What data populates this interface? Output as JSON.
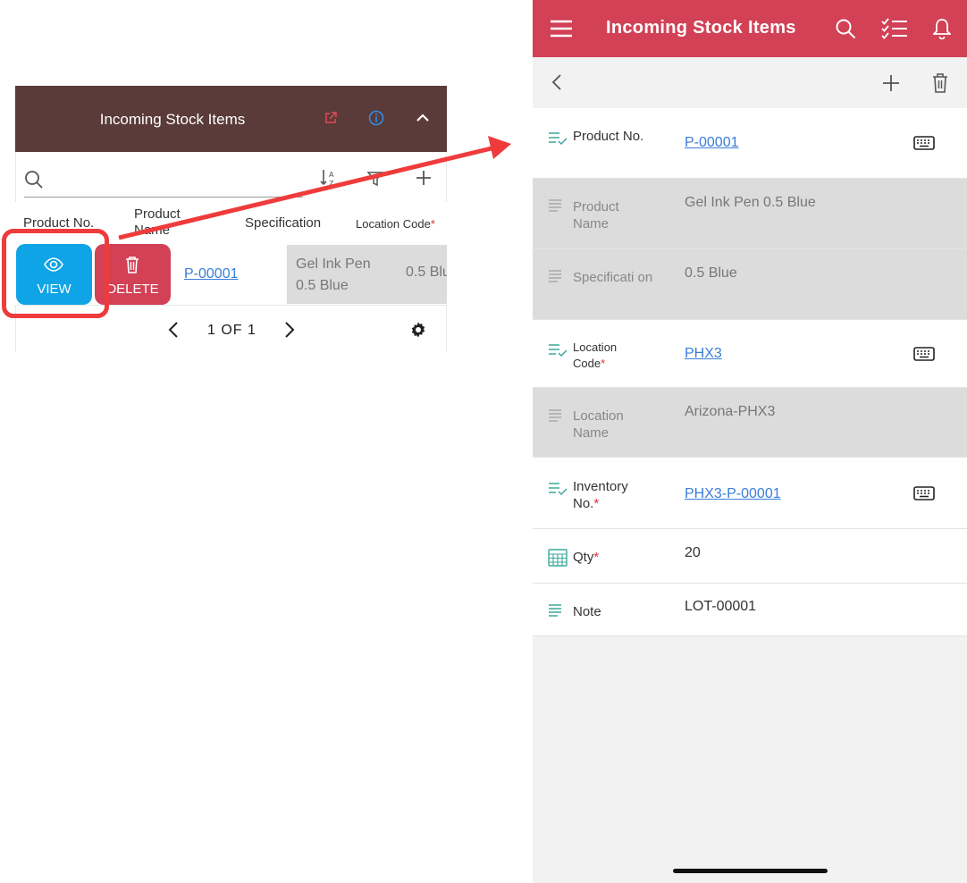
{
  "left_panel": {
    "title": "Incoming Stock Items",
    "columns": {
      "product_no": "Product No.",
      "product_name": "Product Name",
      "specification": "Specification",
      "location_code": "Location Code",
      "required_mark": "*"
    },
    "row": {
      "product_no": "P-00001",
      "specification": "Gel Ink Pen 0.5 Blue",
      "location_partial": "0.5 Blu"
    },
    "view_label": "VIEW",
    "delete_label": "DELETE",
    "pagination": "1 OF 1"
  },
  "right_panel": {
    "title": "Incoming Stock Items",
    "fields": {
      "product_no": {
        "label": "Product No.",
        "value": "P-00001"
      },
      "product_name": {
        "label": "Product Name",
        "value": "Gel Ink Pen 0.5 Blue"
      },
      "specification": {
        "label": "Specificati on",
        "value": "0.5 Blue"
      },
      "location_code": {
        "label": "Location Code",
        "value": "PHX3"
      },
      "location_name": {
        "label": "Location Name",
        "value": "Arizona-PHX3"
      },
      "inventory_no": {
        "label": "Inventory No.",
        "value": "PHX3-P-00001"
      },
      "qty": {
        "label": "Qty",
        "value": "20"
      },
      "note": {
        "label": "Note",
        "value": "LOT-00001"
      }
    },
    "required_mark": "*"
  },
  "colors": {
    "left_header": "#5a3b39",
    "right_header": "#d24155",
    "view_button": "#0fa4e6",
    "delete_button": "#d24155",
    "highlight": "#ef3b3b",
    "link": "#3a7dd8",
    "icon_teal": "#3ba99c"
  },
  "icons": [
    "external-link-icon",
    "info-icon",
    "chevron-up-icon",
    "search-icon",
    "sort-icon",
    "filter-icon",
    "plus-icon",
    "eye-icon",
    "trash-icon",
    "chevron-left-icon",
    "chevron-right-icon",
    "gear-icon",
    "hamburger-icon",
    "checklist-icon",
    "bell-icon",
    "keyboard-icon",
    "calculator-icon",
    "text-lines-icon"
  ]
}
